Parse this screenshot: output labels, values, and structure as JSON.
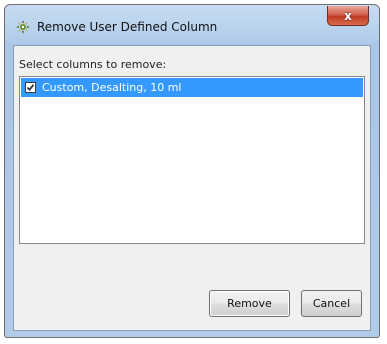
{
  "window": {
    "title": "Remove User Defined Column",
    "close_glyph": "x",
    "icon": "puzzle-gear-icon"
  },
  "dialog": {
    "prompt": "Select columns to remove:",
    "columns": [
      {
        "label": "Custom, Desalting, 10 ml",
        "checked": true,
        "selected": true
      }
    ]
  },
  "buttons": {
    "remove": "Remove",
    "cancel": "Cancel"
  },
  "colors": {
    "selection": "#3399ff",
    "close_button": "#c23b24"
  }
}
